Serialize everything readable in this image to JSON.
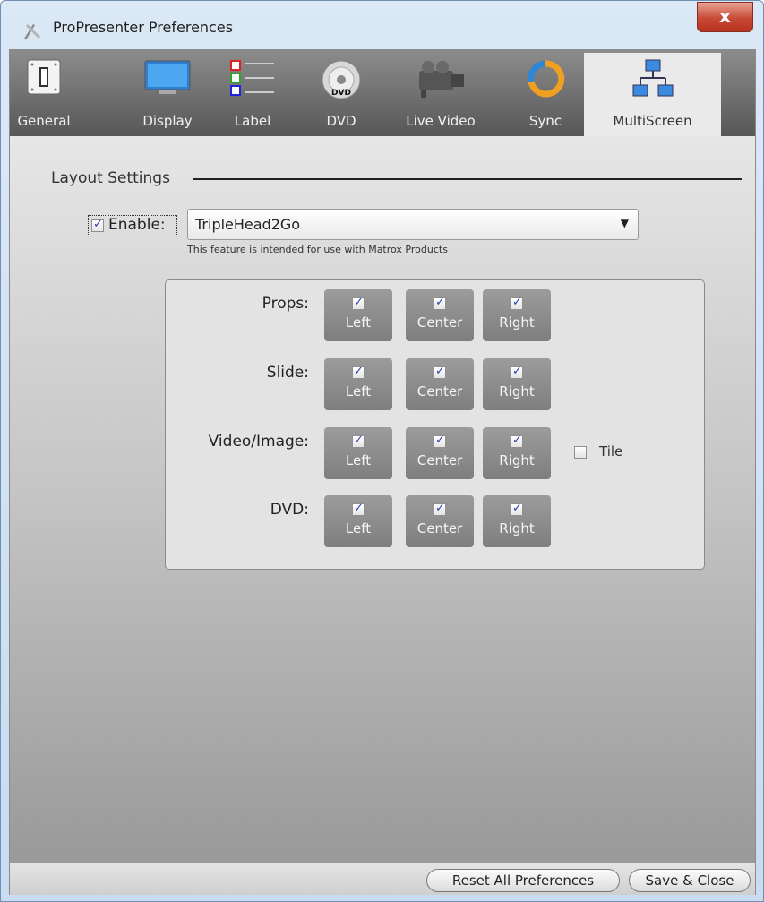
{
  "window": {
    "title": "ProPresenter Preferences",
    "close_label": "x"
  },
  "tabs": [
    {
      "label": "General",
      "icon": "switch-icon",
      "active": false
    },
    {
      "label": "Display",
      "icon": "monitor-icon",
      "active": false
    },
    {
      "label": "Label",
      "icon": "color-list-icon",
      "active": false
    },
    {
      "label": "DVD",
      "icon": "dvd-disc-icon",
      "active": false
    },
    {
      "label": "Live Video",
      "icon": "video-camera-icon",
      "active": false
    },
    {
      "label": "Sync",
      "icon": "sync-icon",
      "active": false
    },
    {
      "label": "MultiScreen",
      "icon": "multiscreen-network-icon",
      "active": true
    }
  ],
  "layout": {
    "section_title": "Layout Settings",
    "enable_label": "Enable:",
    "enable_checked": true,
    "device_value": "TripleHead2Go",
    "hint": "This feature is intended for use with Matrox Products"
  },
  "rows": [
    {
      "label": "Props:",
      "buttons": [
        "Left",
        "Center",
        "Right"
      ]
    },
    {
      "label": "Slide:",
      "buttons": [
        "Left",
        "Center",
        "Right"
      ]
    },
    {
      "label": "Video/Image:",
      "buttons": [
        "Left",
        "Center",
        "Right"
      ]
    },
    {
      "label": "DVD:",
      "buttons": [
        "Left",
        "Center",
        "Right"
      ]
    }
  ],
  "tile": {
    "label": "Tile",
    "checked": false
  },
  "footer": {
    "reset_label": "Reset All Preferences",
    "save_label": "Save & Close"
  },
  "colors": {
    "tab_bar": "#6e6e6e",
    "check": "#2a3fb4",
    "close": "#c74a36"
  }
}
